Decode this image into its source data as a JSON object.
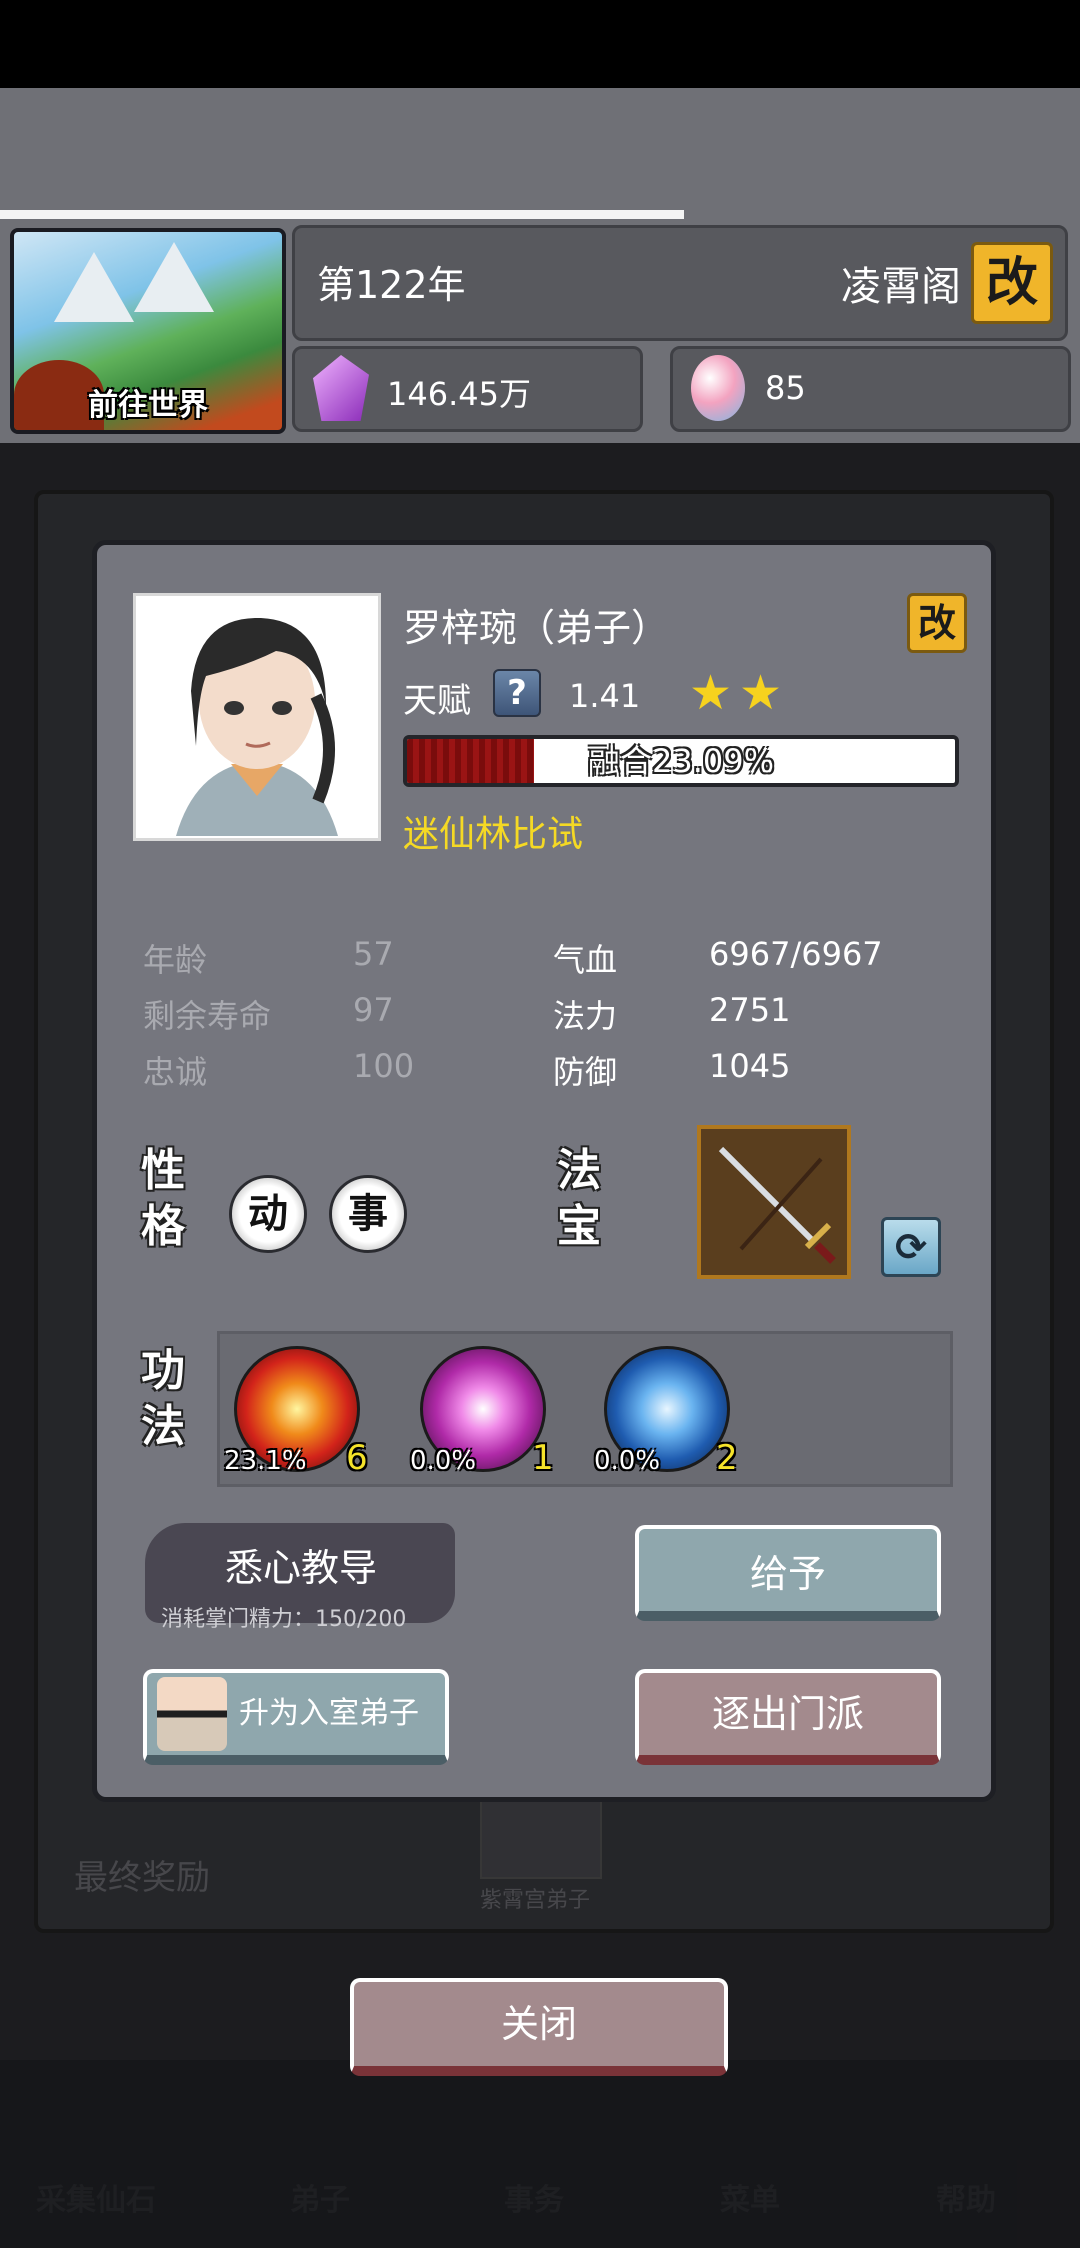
{
  "header": {
    "world_button_label": "前往世界",
    "year": "第122年",
    "sect_name": "凌霄阁",
    "rename_label": "改",
    "spirit_stones": "146.45万",
    "gems": "85"
  },
  "background": {
    "final_reward": "最终奖励",
    "disciple_caption": "紫霄宫弟子",
    "nav": [
      "采集仙石",
      "弟子",
      "事务",
      "菜单",
      "帮助"
    ]
  },
  "disciple": {
    "name": "罗梓琬（弟子）",
    "rename_label": "改",
    "talent_label": "天赋",
    "help_label": "?",
    "talent_value": "1.41",
    "stars": 2,
    "fusion_label": "融合23.09%",
    "fusion_progress": 0.2309,
    "event": "迷仙林比试",
    "stats_left": [
      {
        "label": "年龄",
        "value": "57"
      },
      {
        "label": "剩余寿命",
        "value": "97"
      },
      {
        "label": "忠诚",
        "value": "100"
      }
    ],
    "stats_right": [
      {
        "label": "气血",
        "value": "6967/6967"
      },
      {
        "label": "法力",
        "value": "2751"
      },
      {
        "label": "防御",
        "value": "1045"
      }
    ],
    "personality_title": [
      "性",
      "格"
    ],
    "traits": [
      "动",
      "事"
    ],
    "treasure_title": [
      "法",
      "宝"
    ],
    "skills_title": [
      "功",
      "法"
    ],
    "skills": [
      {
        "percent": "23.1%",
        "level": "6",
        "color": "#e8401c"
      },
      {
        "percent": "0.0%",
        "level": "1",
        "color": "#c63fb8"
      },
      {
        "percent": "0.0%",
        "level": "2",
        "color": "#2f74c7"
      }
    ],
    "teach_label": "悉心教导",
    "teach_cost": "消耗掌门精力：150/200",
    "give_label": "给予",
    "promote_label": "升为入室弟子",
    "expel_label": "逐出门派"
  },
  "close_label": "关闭"
}
